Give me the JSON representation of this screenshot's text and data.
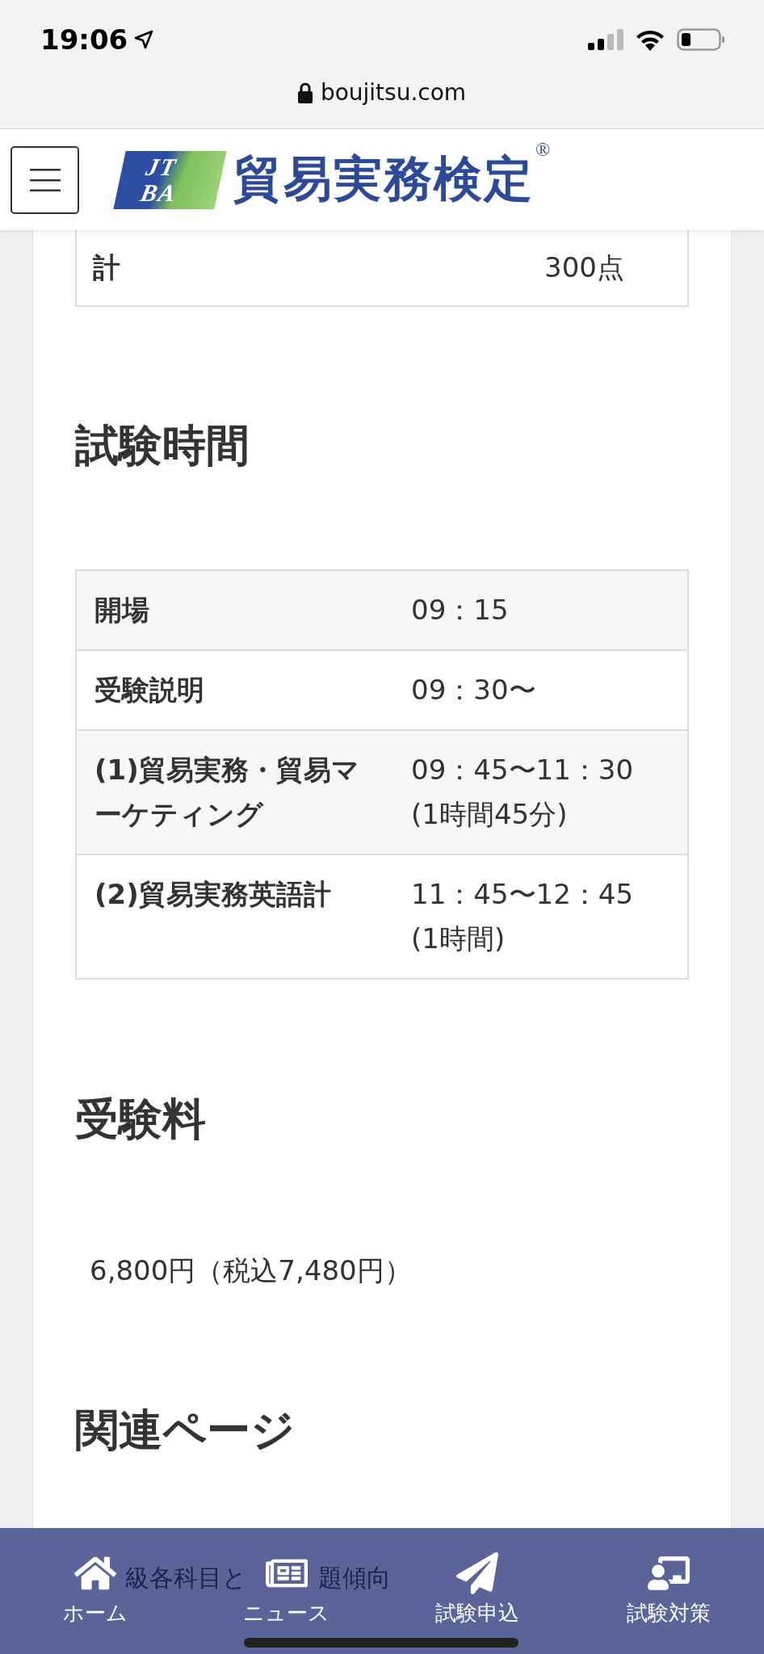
{
  "status_bar": {
    "time": "19:06"
  },
  "browser": {
    "url": "boujitsu.com"
  },
  "header": {
    "logo": {
      "mark_top": "JT",
      "mark_bottom": "BA",
      "title": "貿易実務検定",
      "registered": "®"
    }
  },
  "score_total": {
    "label": "計",
    "value": "300点"
  },
  "sections": [
    {
      "kind": "table",
      "heading": "試験時間",
      "rows": [
        {
          "label": "開場",
          "value": "09：15"
        },
        {
          "label": "受験説明",
          "value": "09：30〜"
        },
        {
          "label": "(1)貿易実務・貿易マーケティング",
          "value": "09：45〜11：30 (1時間45分)"
        },
        {
          "label": "(2)貿易実務英語計",
          "value": "11：45〜12：45 (1時間)"
        }
      ]
    },
    {
      "kind": "text",
      "heading": "受験料",
      "text": "6,800円（税込7,480円）"
    },
    {
      "kind": "links",
      "heading": "関連ページ",
      "links": [
        "級各科目と",
        "題傾向"
      ]
    }
  ],
  "bottom_nav": [
    {
      "kind": "home",
      "label": "ホーム"
    },
    {
      "kind": "news",
      "label": "ニュース"
    },
    {
      "kind": "apply",
      "label": "試験申込"
    },
    {
      "kind": "study",
      "label": "試験対策"
    }
  ]
}
